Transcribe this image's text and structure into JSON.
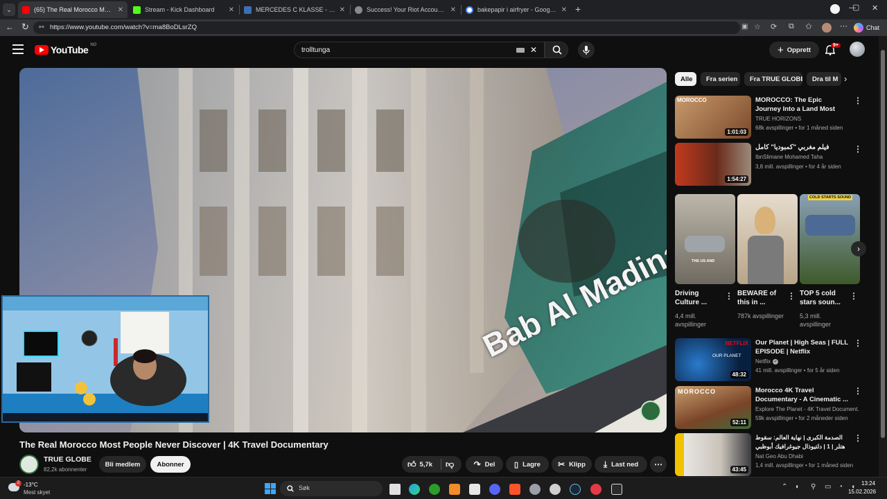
{
  "browser": {
    "tabs": [
      {
        "title": "(65) The Real Morocco Most People Never Discover | 4K Travel Documentary",
        "favicon_color": "#ff0000",
        "active": true
      },
      {
        "title": "Stream - Kick Dashboard",
        "favicon_color": "#53fc18",
        "active": false
      },
      {
        "title": "MERCEDES C KLASSE - W204 - AMG",
        "favicon_color": "#3b6fb6",
        "active": false
      },
      {
        "title": "Success! Your Riot Account is now...",
        "favicon_color": "#8a8a8a",
        "active": false
      },
      {
        "title": "bakepapir i airfryer - Google Search",
        "favicon_color": "#4285f4",
        "active": false
      }
    ],
    "url": "https://www.youtube.com/watch?v=ma8BoDLsrZQ",
    "copilot_label": "Chat"
  },
  "header": {
    "logo_text": "YouTube",
    "region": "NO",
    "search_value": "trolltunga",
    "create_label": "Opprett",
    "notification_count": "9+"
  },
  "video": {
    "overlay_text": "Bab Al Madina",
    "title": "The Real Morocco Most People Never Discover | 4K Travel Documentary",
    "channel": "TRUE GLOBE",
    "subscribers": "82,2k abonnenter",
    "join_label": "Bli medlem",
    "subscribe_label": "Abonner",
    "likes": "5,7k",
    "share_label": "Del",
    "save_label": "Lagre",
    "clip_label": "Klipp",
    "download_label": "Last ned"
  },
  "chips": [
    "Alle",
    "Fra serien",
    "Fra TRUE GLOBE",
    "Dra til M"
  ],
  "recommendations": [
    {
      "title": "MOROCCO: The Epic Journey Into a Land Most Travelers ...",
      "channel": "TRUE HORIZONS",
      "meta": "68k avspillinger • for 1 måned siden",
      "duration": "1:01:03",
      "thumb_label": "MOROCCO",
      "color": "#a0704a"
    },
    {
      "title": "فيلم مغربي \"كمبوديا\" كامل",
      "channel": "IbnSlimane Mohamed Taha",
      "meta": "3,8 mill. avspillinger • for 4 år siden",
      "duration": "1:54:27",
      "thumb_label": "",
      "color": "#7a2a1a"
    }
  ],
  "shorts": [
    {
      "title": "Driving Culture ...",
      "views": "4,4 mill. avspillinger",
      "label": "THE US AND",
      "color": "#7d7a72"
    },
    {
      "title": "BEWARE of this in ...",
      "views": "787k avspillinger",
      "label": "",
      "color": "#c8b89a"
    },
    {
      "title": "TOP 5 cold stars soun...",
      "views": "5,3 mill. avspillinger",
      "label": "COLD STARTS SOUND",
      "color": "#4a6a3a"
    }
  ],
  "recommendations2": [
    {
      "title": "Our Planet | High Seas | FULL EPISODE | Netflix",
      "channel": "Netflix",
      "meta": "41 mill. avspillinger • for 5 år siden",
      "duration": "48:32",
      "thumb_label": "NETFLIX",
      "thumb_label2": "OUR PLANET",
      "color": "#0a2a55"
    },
    {
      "title": "Morocco 4K Travel Documentary - A Cinematic ...",
      "channel": "Explore The Planet - 4K Travel Document...",
      "meta": "59k avspillinger • for 2 måneder siden",
      "duration": "52:11",
      "thumb_label": "MOROCCO",
      "thumb_label2": "",
      "color": "#8a5a35"
    },
    {
      "title": "الصدمة الكبرى | نهاية العالم: سقوط هتلر | 1 | دلتيوذال جيوغرافيك أبوظبي",
      "channel": "Nat Geo Abu Dhabi",
      "meta": "1,4 mill. avspillinger • for 1 måned siden",
      "duration": "43:45",
      "thumb_label": "",
      "thumb_label2": "",
      "color": "#f2c200"
    }
  ],
  "taskbar": {
    "weather_temp": "-13°C",
    "weather_desc": "Mest skyet",
    "search_placeholder": "Søk",
    "time": "13:24",
    "date": "15.02.2026",
    "weather_badge": "2"
  }
}
